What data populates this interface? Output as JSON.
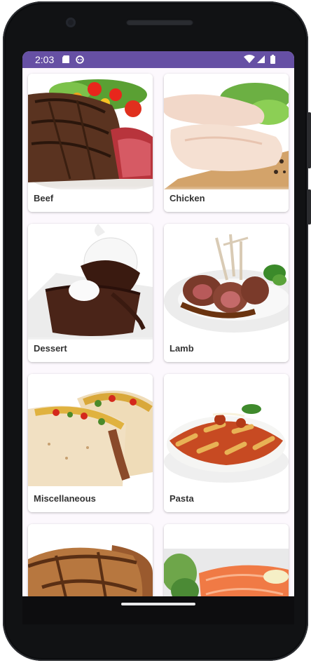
{
  "status_bar": {
    "time": "2:03",
    "left_icons": [
      "sd-card-icon",
      "android-icon"
    ],
    "right_icons": [
      "wifi-icon",
      "signal-icon",
      "battery-icon"
    ],
    "color": "#6650a4"
  },
  "categories": [
    {
      "label": "Beef",
      "image": "beef-steak-image"
    },
    {
      "label": "Chicken",
      "image": "raw-chicken-image"
    },
    {
      "label": "Dessert",
      "image": "brownie-sundae-image"
    },
    {
      "label": "Lamb",
      "image": "lamb-chops-image"
    },
    {
      "label": "Miscellaneous",
      "image": "tacos-image"
    },
    {
      "label": "Pasta",
      "image": "penne-pasta-image"
    },
    {
      "label": "",
      "image": "pork-chop-image"
    },
    {
      "label": "",
      "image": "salmon-plate-image"
    }
  ]
}
